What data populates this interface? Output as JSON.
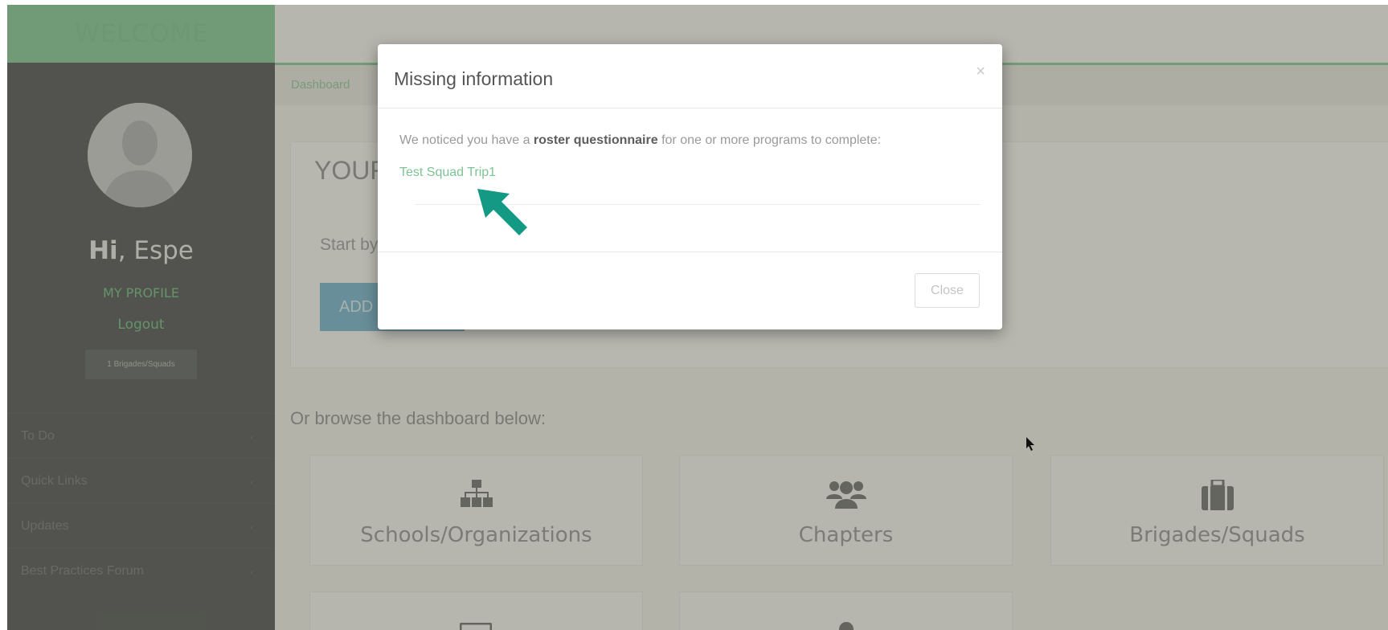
{
  "sidebar": {
    "welcome": "WELCOME",
    "greeting_bold": "Hi",
    "greeting_rest": ", Espe",
    "profile_link": "MY PROFILE",
    "logout_link": "Logout",
    "badge": "1 Brigades/Squads",
    "nav": [
      {
        "label": "To Do"
      },
      {
        "label": "Quick Links"
      },
      {
        "label": "Updates"
      },
      {
        "label": "Best Practices Forum"
      }
    ]
  },
  "breadcrumb": "Dashboard",
  "main": {
    "title": "YOUR",
    "start_text": "Start by",
    "add_button": "ADD",
    "browse_text": "Or browse the dashboard below:",
    "cards": [
      {
        "label": "Schools/Organizations",
        "icon": "sitemap-icon"
      },
      {
        "label": "Chapters",
        "icon": "users-icon"
      },
      {
        "label": "Brigades/Squads",
        "icon": "briefcase-icon"
      }
    ]
  },
  "modal": {
    "title": "Missing information",
    "close_x": "×",
    "text_before": "We noticed you have a ",
    "text_bold": "roster questionnaire",
    "text_after": " for one or more programs to complete:",
    "link": "Test Squad Trip1",
    "close_button": "Close"
  },
  "colors": {
    "accent_green": "#6cc184",
    "sidebar_bg": "#2e3133",
    "add_button": "#5aa7c8",
    "annotation_arrow": "#149a84"
  }
}
